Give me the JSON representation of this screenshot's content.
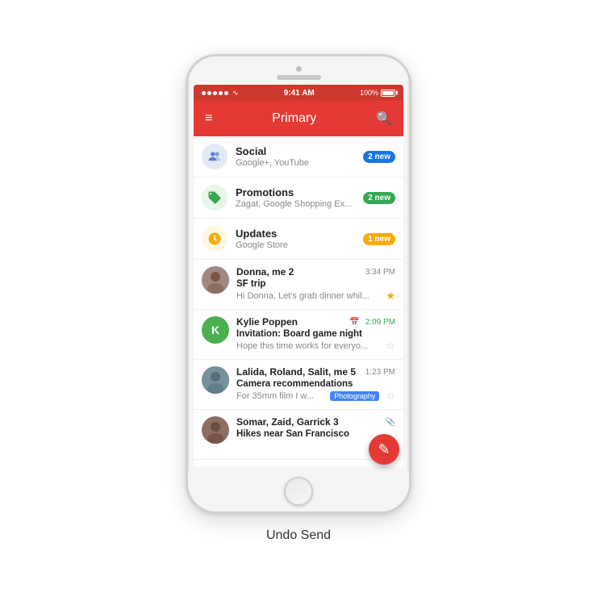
{
  "caption": "Undo Send",
  "phone": {
    "status_bar": {
      "time": "9:41 AM",
      "battery_text": "100%"
    },
    "toolbar": {
      "title": "Primary",
      "menu_icon": "≡",
      "search_icon": "🔍"
    },
    "categories": [
      {
        "id": "social",
        "name": "Social",
        "preview": "Google+, YouTube",
        "badge": "2 new",
        "badge_color": "blue"
      },
      {
        "id": "promotions",
        "name": "Promotions",
        "preview": "Zagat, Google Shopping Ex...",
        "badge": "2 new",
        "badge_color": "green"
      },
      {
        "id": "updates",
        "name": "Updates",
        "preview": "Google Store",
        "badge": "1 new",
        "badge_color": "orange"
      }
    ],
    "emails": [
      {
        "id": "donna",
        "sender": "Donna, me 2",
        "time": "3:34 PM",
        "time_color": "normal",
        "subject": "SF trip",
        "preview": "Hi Donna, Let's grab dinner whil...",
        "starred": true,
        "avatar_type": "photo",
        "avatar_letter": "D"
      },
      {
        "id": "kylie",
        "sender": "Kylie Poppen",
        "time": "2:09 PM",
        "time_color": "green",
        "subject": "Invitation: Board game night",
        "preview": "Hope this time works for everyo...",
        "starred": false,
        "has_calendar": true,
        "avatar_type": "letter",
        "avatar_letter": "K",
        "avatar_color": "green"
      },
      {
        "id": "lalida",
        "sender": "Lalida, Roland, Salit, me 5",
        "time": "1:23 PM",
        "time_color": "normal",
        "subject": "Camera recommendations",
        "preview": "For 35mm film I w...",
        "tag": "Photography",
        "starred": false,
        "avatar_type": "photo",
        "avatar_letter": "L"
      },
      {
        "id": "somar",
        "sender": "Somar, Zaid, Garrick 3",
        "time": "",
        "subject": "Hikes near San Francisco",
        "preview": "",
        "starred": false,
        "has_attachment": true,
        "avatar_type": "photo",
        "avatar_letter": "S"
      }
    ],
    "fab_icon": "✏"
  }
}
